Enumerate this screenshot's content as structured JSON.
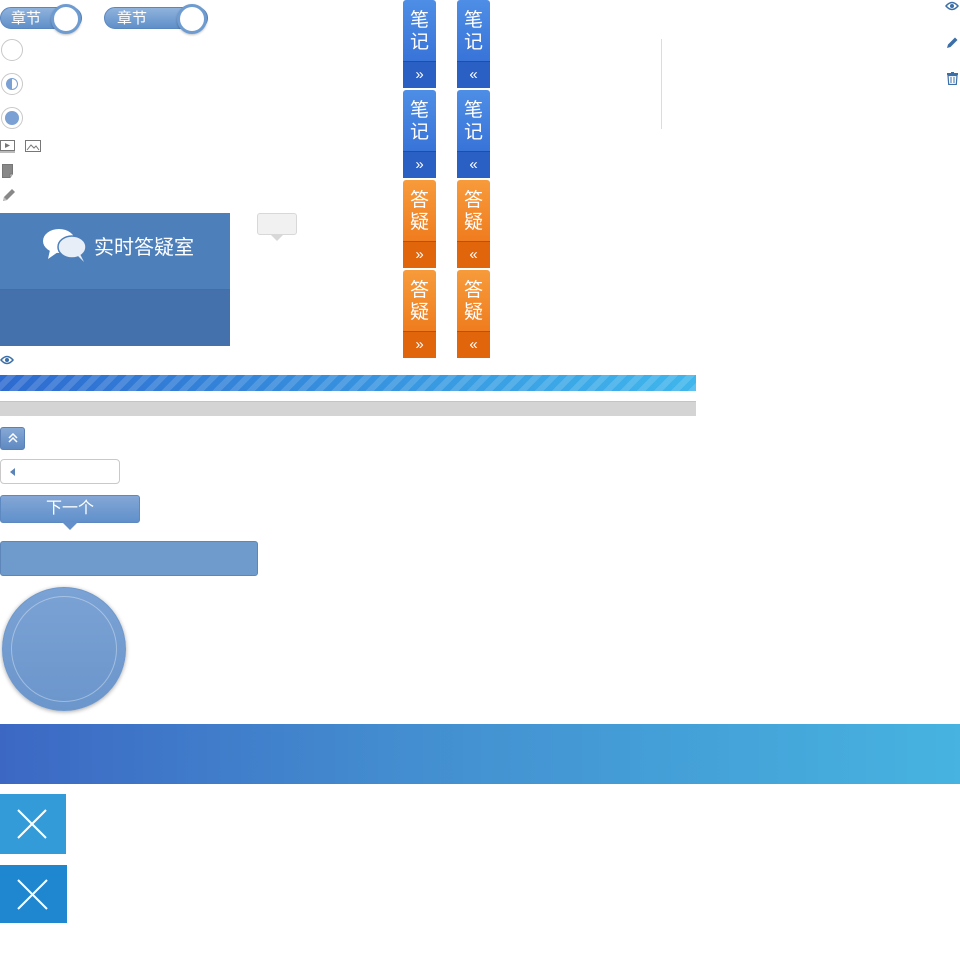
{
  "chapter_toggles": [
    {
      "label": "章节",
      "knob_side": "right"
    },
    {
      "label": "章节",
      "knob_side": "right"
    }
  ],
  "radios": [
    {
      "state": "empty"
    },
    {
      "state": "half"
    },
    {
      "state": "full"
    }
  ],
  "small_icons": [
    "video-icon",
    "image-icon",
    "document-icon",
    "pencil-icon"
  ],
  "chat_room": {
    "icon": "speech-bubbles-icon",
    "title": "实时答疑室"
  },
  "side_tabs": {
    "note_label": "笔记",
    "qa_label": "答疑",
    "expand_arrow": "»",
    "collapse_arrow": "«",
    "colors": {
      "blue": "#3a78dc",
      "orange": "#f0801f"
    }
  },
  "right_icons": [
    "eye-icon",
    "pencil-icon",
    "trash-icon"
  ],
  "eye_icon_label": "eye-icon",
  "progress": {
    "striped_fill": 1.0,
    "empty_fill": 0.0
  },
  "back_to_top": {
    "icon": "double-chevron-up-icon"
  },
  "select": {
    "value": "",
    "icon": "caret-left-icon"
  },
  "next_button": {
    "label": "下一个"
  },
  "close_tiles": [
    {
      "icon": "close-icon"
    },
    {
      "icon": "close-icon"
    }
  ],
  "colors": {
    "accent_blue": "#6f9bcc",
    "gradient_start": "#3c68c4",
    "gradient_end": "#46b3e0",
    "tile_blue": "#339bd8",
    "tile_dark_blue": "#1f86d0"
  }
}
